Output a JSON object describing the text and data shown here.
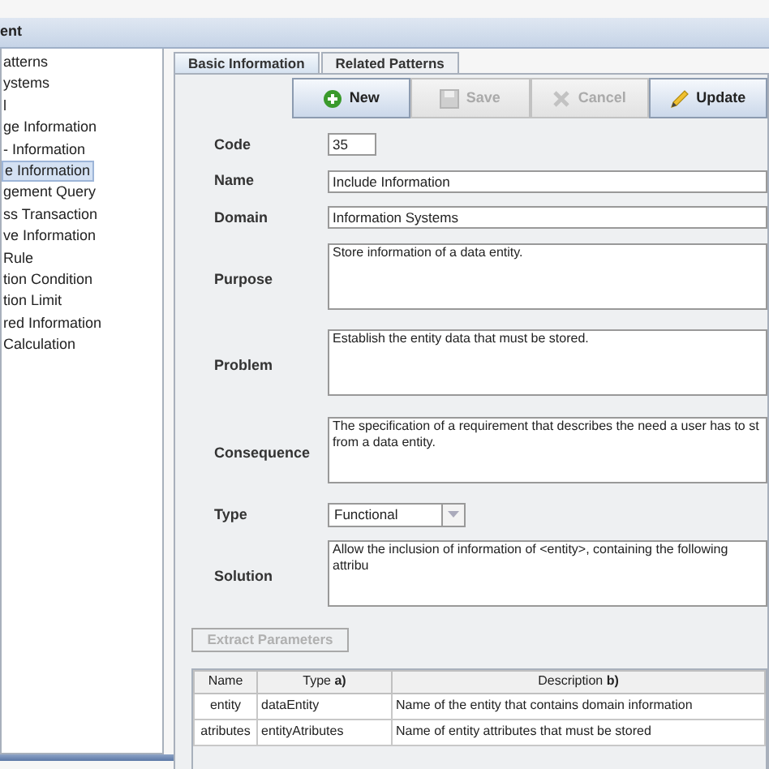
{
  "header": {
    "title": "ent"
  },
  "tree": {
    "items": [
      {
        "label": "atterns",
        "selected": false
      },
      {
        "label": "ystems",
        "selected": false
      },
      {
        "label": "l",
        "selected": false
      },
      {
        "label": "ge Information",
        "selected": false
      },
      {
        "label": "- Information",
        "selected": false
      },
      {
        "label": "e Information",
        "selected": true
      },
      {
        "label": "gement Query",
        "selected": false
      },
      {
        "label": "ss Transaction",
        "selected": false
      },
      {
        "label": "ve Information",
        "selected": false
      },
      {
        "label": "Rule",
        "selected": false
      },
      {
        "label": "tion Condition",
        "selected": false
      },
      {
        "label": "tion Limit",
        "selected": false
      },
      {
        "label": "red Information",
        "selected": false
      },
      {
        "label": "Calculation",
        "selected": false
      }
    ]
  },
  "tabs": [
    {
      "label": "Basic Information",
      "selected": true
    },
    {
      "label": "Related Patterns",
      "selected": false
    }
  ],
  "toolbar": [
    {
      "label": "New",
      "kind": "new",
      "disabled": false
    },
    {
      "label": "Save",
      "kind": "save",
      "disabled": true
    },
    {
      "label": "Cancel",
      "kind": "cancel",
      "disabled": true
    },
    {
      "label": "Update",
      "kind": "update",
      "disabled": false
    }
  ],
  "form": [
    {
      "label": "Code",
      "kind": "short",
      "value": "35"
    },
    {
      "label": "Name",
      "kind": "text",
      "value": "Include Information"
    },
    {
      "label": "Domain",
      "kind": "text",
      "value": "Information Systems"
    },
    {
      "label": "Purpose",
      "kind": "area",
      "value": "Store information of a data entity."
    },
    {
      "label": "Problem",
      "kind": "area",
      "value": "Establish the entity data that must be stored."
    },
    {
      "label": "Consequence",
      "kind": "area",
      "value": "The specification of a requirement that describes the need a user has to st\nfrom a data entity."
    },
    {
      "label": "Type",
      "kind": "combo",
      "value": "Functional"
    },
    {
      "label": "Solution",
      "kind": "area",
      "value": "Allow the inclusion of information of <entity>, containing the following attribu"
    }
  ],
  "extract_button": {
    "label": "Extract Parameters",
    "disabled": true
  },
  "table": {
    "columns": [
      "Name",
      "Type **a)**",
      "Description **b)**"
    ],
    "rows": [
      [
        "entity",
        "dataEntity",
        "Name of the entity that contains domain information"
      ],
      [
        "atributes",
        "entityAtributes",
        "Name of entity attributes that must be stored"
      ]
    ]
  }
}
